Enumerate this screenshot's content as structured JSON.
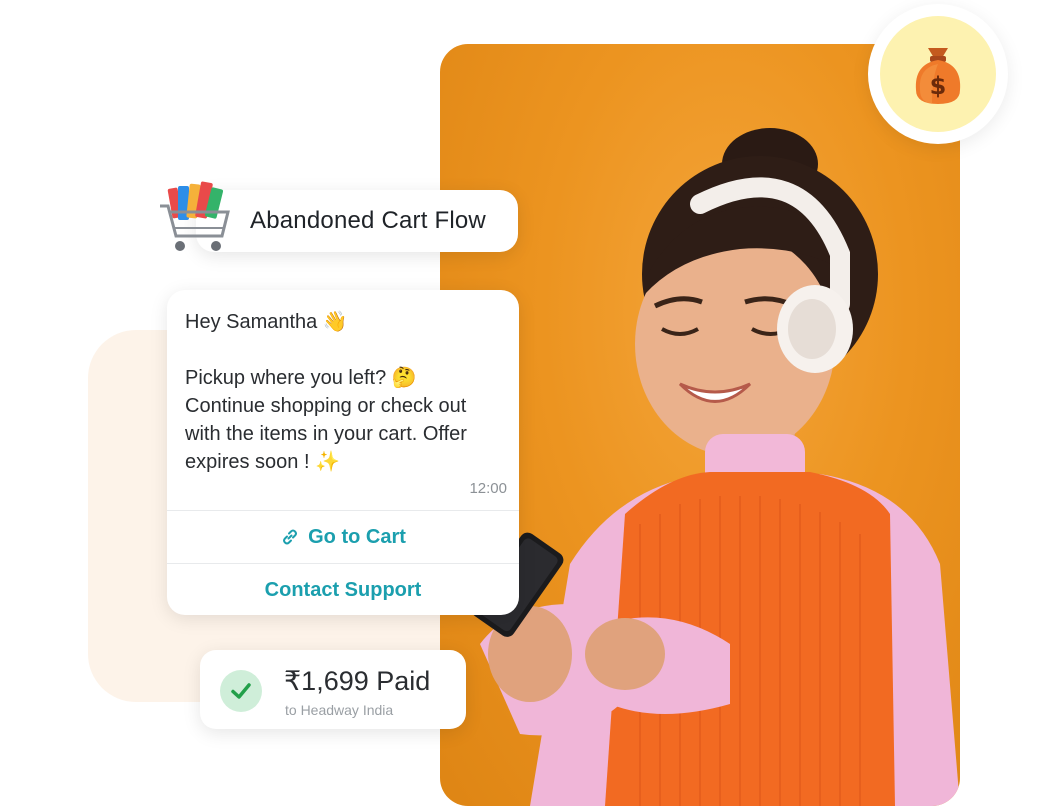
{
  "flow_card": {
    "title": "Abandoned Cart Flow"
  },
  "message": {
    "greeting": "Hey Samantha",
    "greeting_emoji": "👋",
    "line1": "Pickup where you left?",
    "line1_emoji": "🤔",
    "line2": "Continue shopping or check out",
    "line3": "with the items in your cart. Offer",
    "line4": "expires soon !",
    "line4_emoji": "✨",
    "time": "12:00",
    "buttons": {
      "go_to_cart": "Go to Cart",
      "contact_support": "Contact Support"
    }
  },
  "payment": {
    "amount": "₹1,699 Paid",
    "recipient": "to Headway India"
  },
  "icons": {
    "badge": "money-bag-icon",
    "cart": "shopping-cart-icon",
    "link": "link-icon",
    "check": "check-icon"
  },
  "colors": {
    "accent": "#1b9fae",
    "photo_bg": "#ec9420",
    "success": "#22a04a",
    "badge_bg": "#fdf2b0"
  }
}
